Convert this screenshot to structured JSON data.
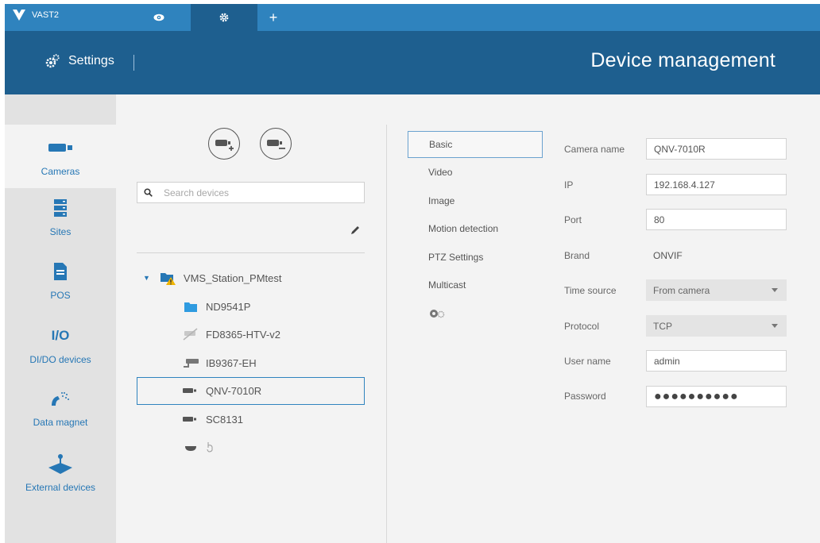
{
  "app": {
    "name": "VAST2"
  },
  "tabs": {
    "add_label": "+"
  },
  "header": {
    "section": "Settings",
    "title": "Device management"
  },
  "sidebar": {
    "items": [
      {
        "label": "Cameras",
        "icon": "camera-icon",
        "active": true
      },
      {
        "label": "Sites",
        "icon": "server-icon"
      },
      {
        "label": "POS",
        "icon": "document-icon"
      },
      {
        "label": "DI/DO devices",
        "icon": "io-icon",
        "icon_text": "I/O"
      },
      {
        "label": "Data magnet",
        "icon": "data-magnet-icon"
      },
      {
        "label": "External devices",
        "icon": "joystick-icon"
      }
    ]
  },
  "devices": {
    "search_placeholder": "Search devices",
    "tree": {
      "root": {
        "label": "VMS_Station_PMtest",
        "icon": "station-warning-icon"
      },
      "children": [
        {
          "label": "ND9541P",
          "icon": "folder-icon"
        },
        {
          "label": "FD8365-HTV-v2",
          "icon": "camera-disconnected-icon"
        },
        {
          "label": "IB9367-EH",
          "icon": "bullet-camera-icon"
        },
        {
          "label": "QNV-7010R",
          "icon": "box-camera-icon",
          "selected": true
        },
        {
          "label": "SC8131",
          "icon": "box-camera-icon"
        },
        {
          "label": "",
          "icon": "dome-camera-icon",
          "extra": "hand-pointer-icon"
        }
      ]
    }
  },
  "menu": {
    "items": [
      "Basic",
      "Video",
      "Image",
      "Motion detection",
      "PTZ Settings",
      "Multicast"
    ],
    "active": "Basic",
    "extra_icon": "advanced-settings-icon"
  },
  "form": {
    "camera_name": {
      "label": "Camera name",
      "value": "QNV-7010R"
    },
    "ip": {
      "label": "IP",
      "value": "192.168.4.127"
    },
    "port": {
      "label": "Port",
      "value": "80"
    },
    "brand": {
      "label": "Brand",
      "value": "ONVIF"
    },
    "time_source": {
      "label": "Time source",
      "value": "From camera"
    },
    "protocol": {
      "label": "Protocol",
      "value": "TCP"
    },
    "user_name": {
      "label": "User name",
      "value": "admin"
    },
    "password": {
      "label": "Password",
      "value": "●●●●●●●●●●"
    }
  },
  "colors": {
    "accent": "#2f83be",
    "header": "#1e5f8f",
    "link": "#2677b5"
  }
}
